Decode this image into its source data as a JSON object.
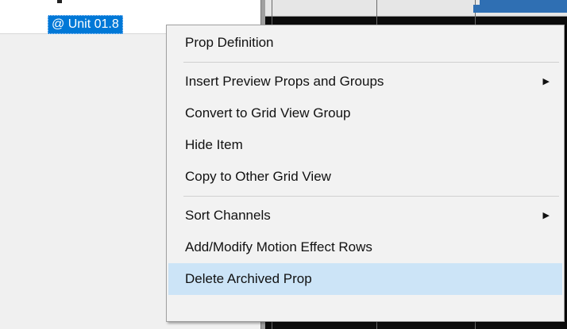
{
  "tree": {
    "selected_item_label": "@ Unit 01.8"
  },
  "context_menu": {
    "groups": [
      [
        {
          "label": "Prop Definition",
          "has_submenu": false
        }
      ],
      [
        {
          "label": "Insert Preview Props and Groups",
          "has_submenu": true
        },
        {
          "label": "Convert to Grid View Group",
          "has_submenu": false
        },
        {
          "label": "Hide Item",
          "has_submenu": false
        },
        {
          "label": "Copy to Other Grid View",
          "has_submenu": false
        }
      ],
      [
        {
          "label": "Sort Channels",
          "has_submenu": true
        },
        {
          "label": "Add/Modify Motion Effect Rows",
          "has_submenu": false
        },
        {
          "label": "Delete Archived Prop",
          "has_submenu": false,
          "highlighted": true
        }
      ]
    ],
    "submenu_arrow_glyph": "▶",
    "colors": {
      "highlight": "#cce4f7",
      "selection": "#0078d7"
    }
  }
}
